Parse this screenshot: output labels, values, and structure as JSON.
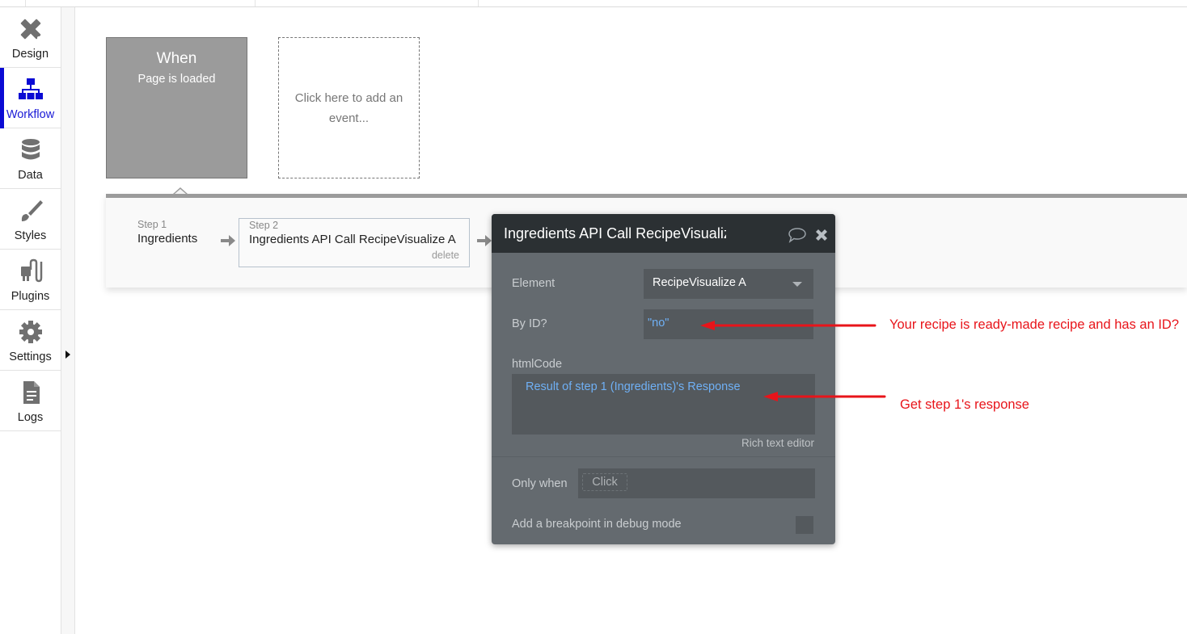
{
  "sidebar": {
    "items": [
      {
        "label": "Design",
        "icon": "design-icon",
        "active": false
      },
      {
        "label": "Workflow",
        "icon": "workflow-icon",
        "active": true
      },
      {
        "label": "Data",
        "icon": "database-icon",
        "active": false
      },
      {
        "label": "Styles",
        "icon": "brush-icon",
        "active": false
      },
      {
        "label": "Plugins",
        "icon": "plug-icon",
        "active": false
      },
      {
        "label": "Settings",
        "icon": "gear-icon",
        "active": false
      },
      {
        "label": "Logs",
        "icon": "document-icon",
        "active": false
      }
    ]
  },
  "event": {
    "title": "When",
    "trigger": "Page is loaded",
    "add_event_label": "Click here to add an event..."
  },
  "steps": [
    {
      "number": "Step 1",
      "name": "Ingredients"
    },
    {
      "number": "Step 2",
      "name": "Ingredients API Call RecipeVisualize A",
      "delete_label": "delete"
    }
  ],
  "popup": {
    "title": "Ingredients API Call RecipeVisualize A",
    "element_label": "Element",
    "element_value": "RecipeVisualize A",
    "by_id_label": "By ID?",
    "by_id_value": "\"no\"",
    "html_code_label": "htmlCode",
    "html_code_value": "Result of step 1 (Ingredients)'s Response",
    "rich_text_editor_label": "Rich text editor",
    "only_when_label": "Only when",
    "only_when_placeholder": "Click",
    "breakpoint_label": "Add a breakpoint in debug mode"
  },
  "annotations": [
    {
      "text": "Your recipe is ready-made recipe and has an ID?",
      "color": "#e8141a"
    },
    {
      "text": "Get step 1's response",
      "color": "#e8141a"
    }
  ],
  "colors": {
    "accent": "#0a0ad4",
    "popup_bg": "#646a6f",
    "popup_header": "#2b3033",
    "expression_blue": "#6fb0f5",
    "annotation_red": "#e8141a"
  }
}
